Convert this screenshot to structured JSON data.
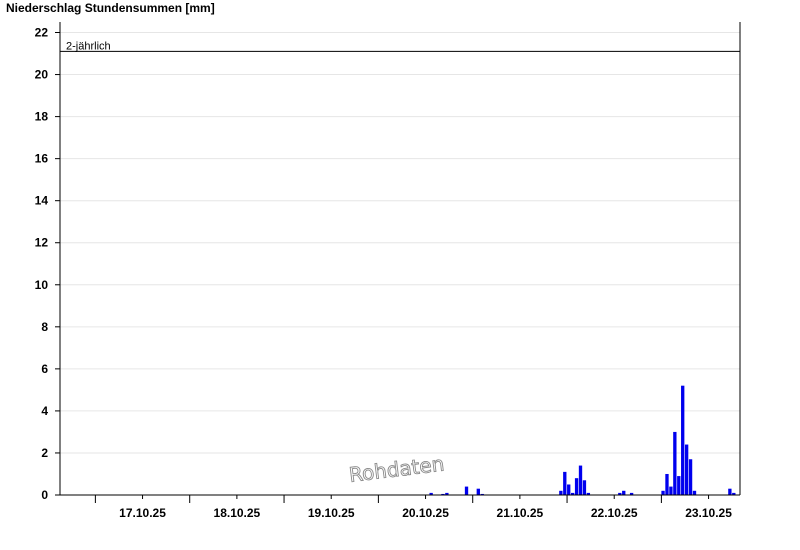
{
  "chart_data": {
    "type": "bar",
    "title": "Niederschlag Stundensummen [mm]",
    "ylim": [
      0,
      22.5
    ],
    "yticks": [
      0,
      2,
      4,
      6,
      8,
      10,
      12,
      14,
      16,
      18,
      20,
      22
    ],
    "x_start": "2025-10-16T15:00",
    "x_end": "2025-10-23T20:00",
    "xtick_labels": [
      {
        "label": "17.10.25",
        "at": "2025-10-17T12:00"
      },
      {
        "label": "18.10.25",
        "at": "2025-10-18T12:00"
      },
      {
        "label": "19.10.25",
        "at": "2025-10-19T12:00"
      },
      {
        "label": "20.10.25",
        "at": "2025-10-20T12:00"
      },
      {
        "label": "21.10.25",
        "at": "2025-10-21T12:00"
      },
      {
        "label": "22.10.25",
        "at": "2025-10-22T12:00"
      },
      {
        "label": "23.10.25",
        "at": "2025-10-23T12:00"
      }
    ],
    "grid": true,
    "bar_color": "#0000ee",
    "reference_line": {
      "label": "2-jährlich",
      "value": 21.1
    },
    "watermark": "Rohdaten",
    "bars": [
      {
        "t": "2025-10-20T13:00",
        "v": 0.1
      },
      {
        "t": "2025-10-20T16:00",
        "v": 0.05
      },
      {
        "t": "2025-10-20T17:00",
        "v": 0.1
      },
      {
        "t": "2025-10-20T22:00",
        "v": 0.4
      },
      {
        "t": "2025-10-21T01:00",
        "v": 0.3
      },
      {
        "t": "2025-10-21T02:00",
        "v": 0.05
      },
      {
        "t": "2025-10-21T22:00",
        "v": 0.2
      },
      {
        "t": "2025-10-21T23:00",
        "v": 1.1
      },
      {
        "t": "2025-10-22T00:00",
        "v": 0.5
      },
      {
        "t": "2025-10-22T01:00",
        "v": 0.1
      },
      {
        "t": "2025-10-22T02:00",
        "v": 0.8
      },
      {
        "t": "2025-10-22T03:00",
        "v": 1.4
      },
      {
        "t": "2025-10-22T04:00",
        "v": 0.7
      },
      {
        "t": "2025-10-22T05:00",
        "v": 0.1
      },
      {
        "t": "2025-10-22T13:00",
        "v": 0.1
      },
      {
        "t": "2025-10-22T14:00",
        "v": 0.2
      },
      {
        "t": "2025-10-22T16:00",
        "v": 0.1
      },
      {
        "t": "2025-10-23T00:00",
        "v": 0.2
      },
      {
        "t": "2025-10-23T01:00",
        "v": 1.0
      },
      {
        "t": "2025-10-23T02:00",
        "v": 0.4
      },
      {
        "t": "2025-10-23T03:00",
        "v": 3.0
      },
      {
        "t": "2025-10-23T04:00",
        "v": 0.9
      },
      {
        "t": "2025-10-23T05:00",
        "v": 5.2
      },
      {
        "t": "2025-10-23T06:00",
        "v": 2.4
      },
      {
        "t": "2025-10-23T07:00",
        "v": 1.7
      },
      {
        "t": "2025-10-23T08:00",
        "v": 0.2
      },
      {
        "t": "2025-10-23T17:00",
        "v": 0.3
      },
      {
        "t": "2025-10-23T18:00",
        "v": 0.1
      }
    ]
  }
}
